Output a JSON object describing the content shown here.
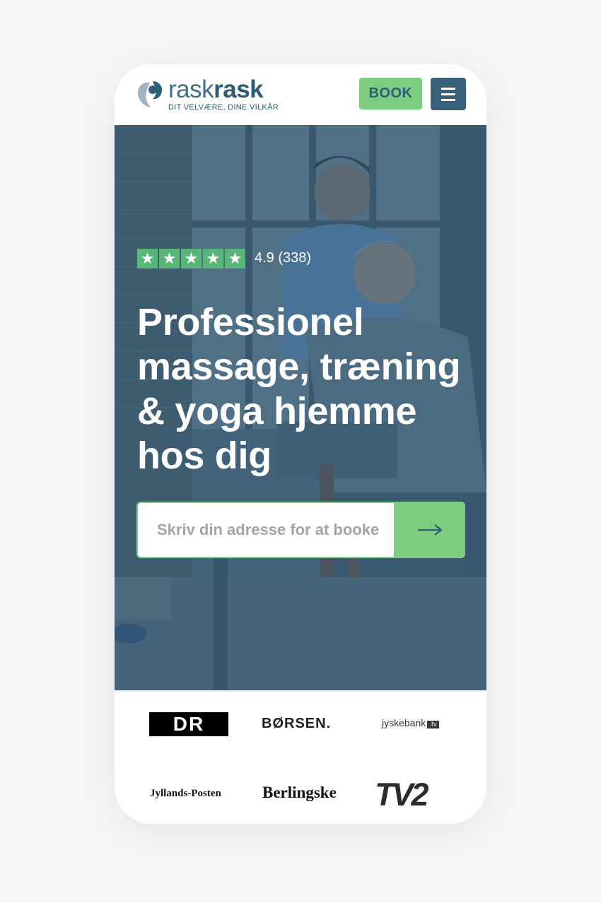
{
  "brand": {
    "name_part1": "rask",
    "name_part2": "rask",
    "tagline": "DIT VELVÆRE, DINE VILKÅR"
  },
  "header": {
    "book_label": "BOOK",
    "menu_icon": "hamburger-menu-icon"
  },
  "hero": {
    "stars": [
      "★",
      "★",
      "★",
      "★",
      "★"
    ],
    "rating": "4.9 (338)",
    "headline": "Professionel massage, træning & yoga hjemme hos dig",
    "search_placeholder": "Skriv din adresse for at booke",
    "submit_icon": "arrow-right-icon"
  },
  "press": {
    "dr": "DR",
    "borsen": "BØRSEN.",
    "jyskebank": "jyskebank",
    "jyskebank_tv": ".tv",
    "jyllands_posten": "Jyllands-Posten",
    "berlingske": "Berlingske",
    "tv2": "TV2"
  },
  "colors": {
    "accent_green": "#7ccd80",
    "brand_blue": "#37617a",
    "trustpilot_green": "#5ab578"
  }
}
